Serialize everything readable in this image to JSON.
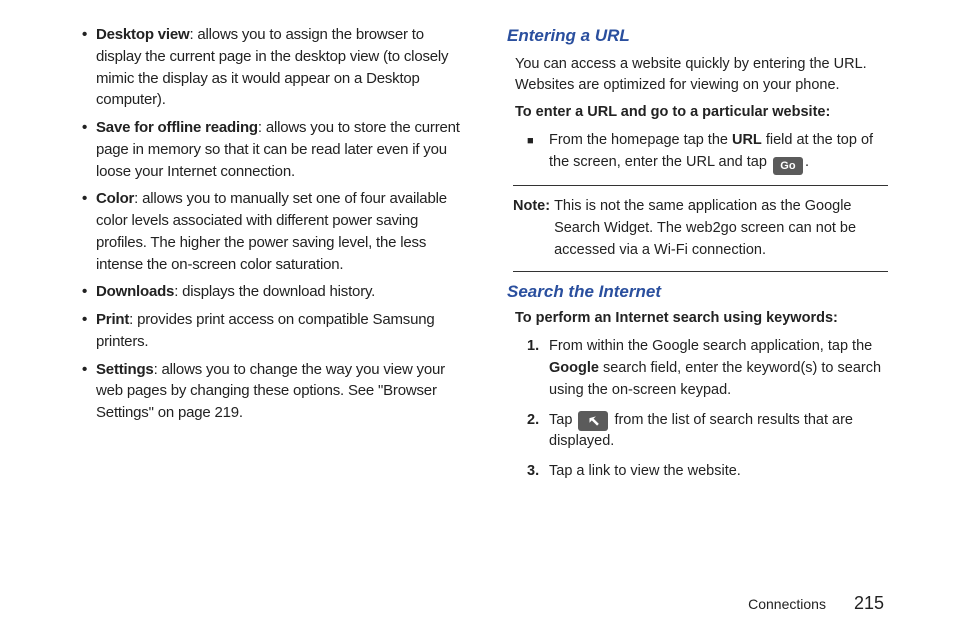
{
  "left": {
    "items": [
      {
        "term": "Desktop view",
        "desc": ": allows you to assign the browser to display the current page in the desktop view (to closely mimic the display as it would appear on a Desktop computer)."
      },
      {
        "term": "Save for offline reading",
        "desc": ": allows you to store the current page in memory so that it can be read later even if you loose your Internet connection."
      },
      {
        "term": "Color",
        "desc": ": allows you to manually set one of four available color levels associated with different power saving profiles. The higher the power saving level, the less intense the on-screen color saturation."
      },
      {
        "term": "Downloads",
        "desc": ": displays the download history."
      },
      {
        "term": "Print",
        "desc": ": provides print access on compatible Samsung printers."
      },
      {
        "term": "Settings",
        "desc": ": allows you to change the way you view your web pages by changing these options. See \"Browser Settings\" on page 219."
      }
    ]
  },
  "right": {
    "url_heading": "Entering a URL",
    "url_intro": "You can access a website quickly by entering the URL. Websites are optimized for viewing on your phone.",
    "url_sub": "To enter a URL and go to a particular website:",
    "url_step_pre": "From the homepage tap the ",
    "url_step_bold": "URL",
    "url_step_mid": " field at the top of the screen, enter the URL and tap ",
    "go_label": "Go",
    "url_step_post": ".",
    "note_label": "Note:",
    "note_text": "This is not the same application as the Google Search Widget. The web2go screen can not be accessed via a Wi-Fi connection.",
    "search_heading": "Search the Internet",
    "search_sub": "To perform an Internet search using keywords:",
    "steps": [
      {
        "n": "1.",
        "pre": "From within the Google search application, tap the ",
        "bold": "Google",
        "post": " search field, enter the keyword(s) to search using the on-screen keypad."
      },
      {
        "n": "2.",
        "pre": "Tap ",
        "icon": true,
        "post": " from the list of search results that are displayed."
      },
      {
        "n": "3.",
        "pre": "Tap a link to view the website."
      }
    ]
  },
  "footer": {
    "section": "Connections",
    "page": "215"
  }
}
